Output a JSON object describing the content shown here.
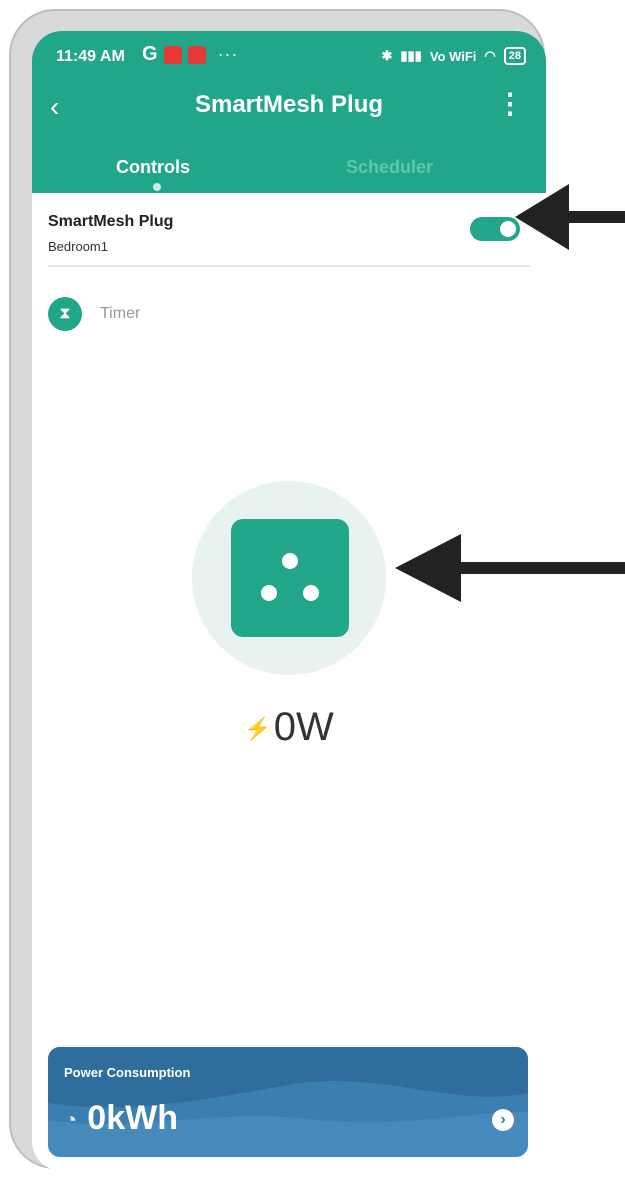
{
  "status_bar": {
    "time": "11:49 AM",
    "g_label": "G",
    "more": "···",
    "signal": "Vo WiFi",
    "battery": "28"
  },
  "nav": {
    "title": "SmartMesh Plug",
    "back": "‹",
    "menu": "⋮"
  },
  "tabs": [
    {
      "label": "Controls",
      "active": true
    },
    {
      "label": "Scheduler",
      "active": false
    }
  ],
  "device": {
    "name": "SmartMesh Plug",
    "room": "Bedroom1",
    "power_on": true
  },
  "timer": {
    "label": "Timer"
  },
  "power": {
    "current": "0W"
  },
  "power_card": {
    "label": "Power Consumption",
    "value": "0kWh"
  },
  "colors": {
    "accent": "#22a68a",
    "card": "#3a7fb0",
    "halo": "#e8f2f1"
  }
}
